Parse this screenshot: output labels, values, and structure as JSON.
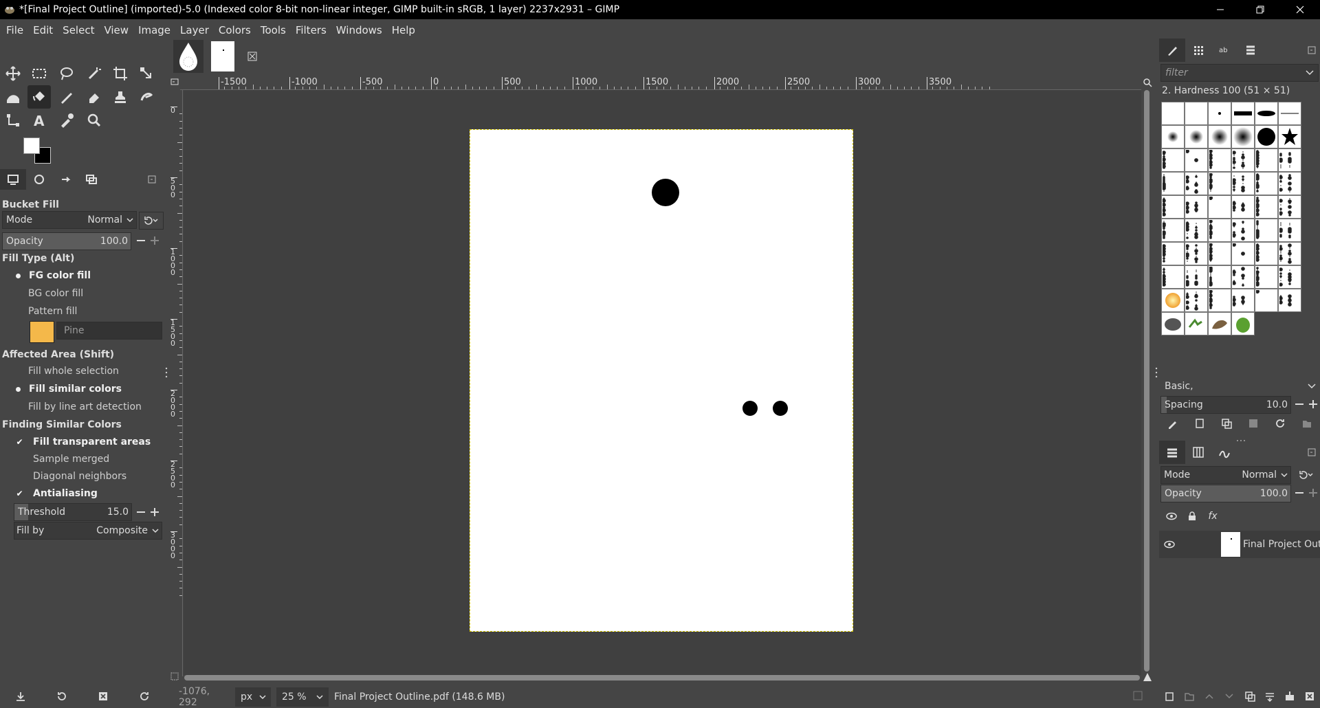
{
  "window": {
    "title": "*[Final Project Outline] (imported)-5.0 (Indexed color 8-bit non-linear integer, GIMP built-in sRGB, 1 layer) 2237x2931 – GIMP"
  },
  "menu": [
    "File",
    "Edit",
    "Select",
    "View",
    "Image",
    "Layer",
    "Colors",
    "Tools",
    "Filters",
    "Windows",
    "Help"
  ],
  "tool_options": {
    "tool_name": "Bucket Fill",
    "mode_label": "Mode",
    "mode_value": "Normal",
    "opacity_label": "Opacity",
    "opacity_value": "100.0",
    "fill_type_title": "Fill Type  (Alt)",
    "fill_types": [
      "FG color fill",
      "BG color fill",
      "Pattern fill"
    ],
    "fill_type_selected": "FG color fill",
    "pattern_name": "Pine",
    "affected_area_title": "Affected Area  (Shift)",
    "affected_areas": [
      "Fill whole selection",
      "Fill similar colors",
      "Fill by line art detection"
    ],
    "affected_selected": "Fill similar colors",
    "finding_title": "Finding Similar Colors",
    "checks": [
      {
        "label": "Fill transparent areas",
        "checked": true
      },
      {
        "label": "Sample merged",
        "checked": false
      },
      {
        "label": "Diagonal neighbors",
        "checked": false
      },
      {
        "label": "Antialiasing",
        "checked": true
      }
    ],
    "threshold_label": "Threshold",
    "threshold_value": "15.0",
    "fill_by_label": "Fill by",
    "fill_by_value": "Composite"
  },
  "ruler": {
    "top_labels": [
      "-1500",
      "-1000",
      "-500",
      "0",
      "500",
      "1000",
      "1500",
      "2000",
      "2500",
      "3000",
      "3500"
    ],
    "left_labels": [
      "0",
      "500",
      "1000",
      "1500",
      "2000",
      "2500",
      "3000"
    ]
  },
  "status": {
    "coords": "-1076, 292",
    "unit": "px",
    "zoom": "25 %",
    "file_info": "Final Project Outline.pdf (148.6 MB)"
  },
  "brushes": {
    "filter_placeholder": "filter",
    "selected_name": "2. Hardness 100 (51 × 51)",
    "preset": "Basic,",
    "spacing_label": "Spacing",
    "spacing_value": "10.0"
  },
  "layers": {
    "mode_label": "Mode",
    "mode_value": "Normal",
    "opacity_label": "Opacity",
    "opacity_value": "100.0",
    "layer_name": "Final Project Outline.pdf"
  }
}
